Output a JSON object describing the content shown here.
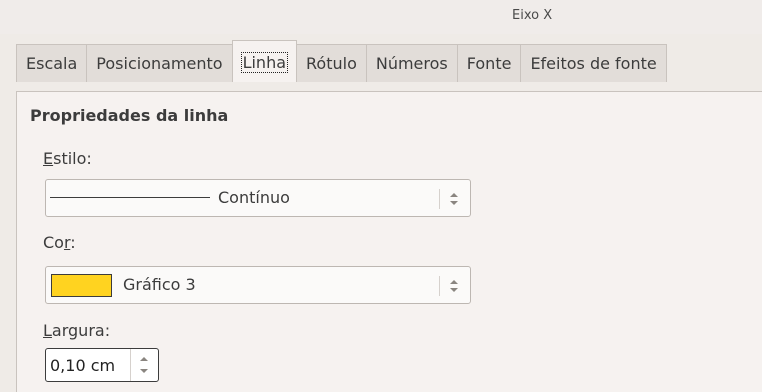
{
  "window": {
    "title": "Eixo X"
  },
  "tabs": [
    {
      "label": "Escala"
    },
    {
      "label": "Posicionamento"
    },
    {
      "label": "Linha",
      "active": true
    },
    {
      "label": "Rótulo"
    },
    {
      "label": "Números"
    },
    {
      "label": "Fonte"
    },
    {
      "label": "Efeitos de fonte"
    }
  ],
  "section": {
    "title": "Propriedades da linha"
  },
  "style_field": {
    "label_mnemonic": "E",
    "label_rest": "stilo:",
    "value": "Contínuo"
  },
  "color_field": {
    "label_start": "Co",
    "label_mnemonic": "r",
    "label_end": ":",
    "value": "Gráfico 3",
    "swatch_color": "#FFD320"
  },
  "width_field": {
    "label_mnemonic": "L",
    "label_rest": "argura:",
    "value": "0,10 cm"
  },
  "icons": {
    "combo_arrows": "up-down-arrows-icon",
    "spin_arrows": "spin-up-down-icon"
  }
}
